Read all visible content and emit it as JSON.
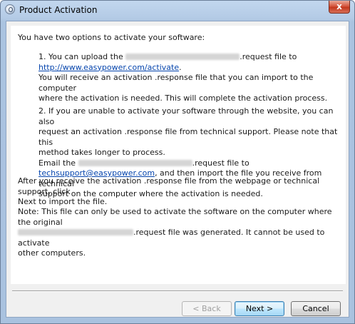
{
  "window": {
    "title": "Product Activation",
    "close_glyph": "x"
  },
  "intro": "You have two options to activate your software:",
  "option1": {
    "line1_prefix": "1. You can upload the",
    "line1_suffix": ".request file to",
    "link": "http://www.easypower.com/activate",
    "link_trail": ".",
    "line3": "You will receive an activation .response file that you can import to the computer",
    "line4": "where the activation is needed. This will complete the activation process."
  },
  "option2": {
    "line1": "2. If you are unable to activate your software through the website, you can also",
    "line2": "request an activation .response file from technical support. Please note that this",
    "line3": "method takes longer to process.",
    "email_prefix": "Email the",
    "email_suffix": ".request file to",
    "email_link": "techsupport@easypower.com",
    "email_after": ", and then import the file you receive from technical",
    "line6": "support on the computer where the activation is needed."
  },
  "after": {
    "line1": "After you receive the activation .response file from the webpage or technical support, click",
    "line2": "Next to import the file."
  },
  "note": {
    "line1": "Note: This file can only be used to activate the software on the computer where the original",
    "line2_suffix": ".request file was generated. It cannot be used to activate",
    "line3": "other computers."
  },
  "buttons": {
    "back": "< Back",
    "next": "Next >",
    "cancel": "Cancel"
  },
  "icons": {
    "app": "activation-app-icon",
    "close": "close-icon"
  }
}
